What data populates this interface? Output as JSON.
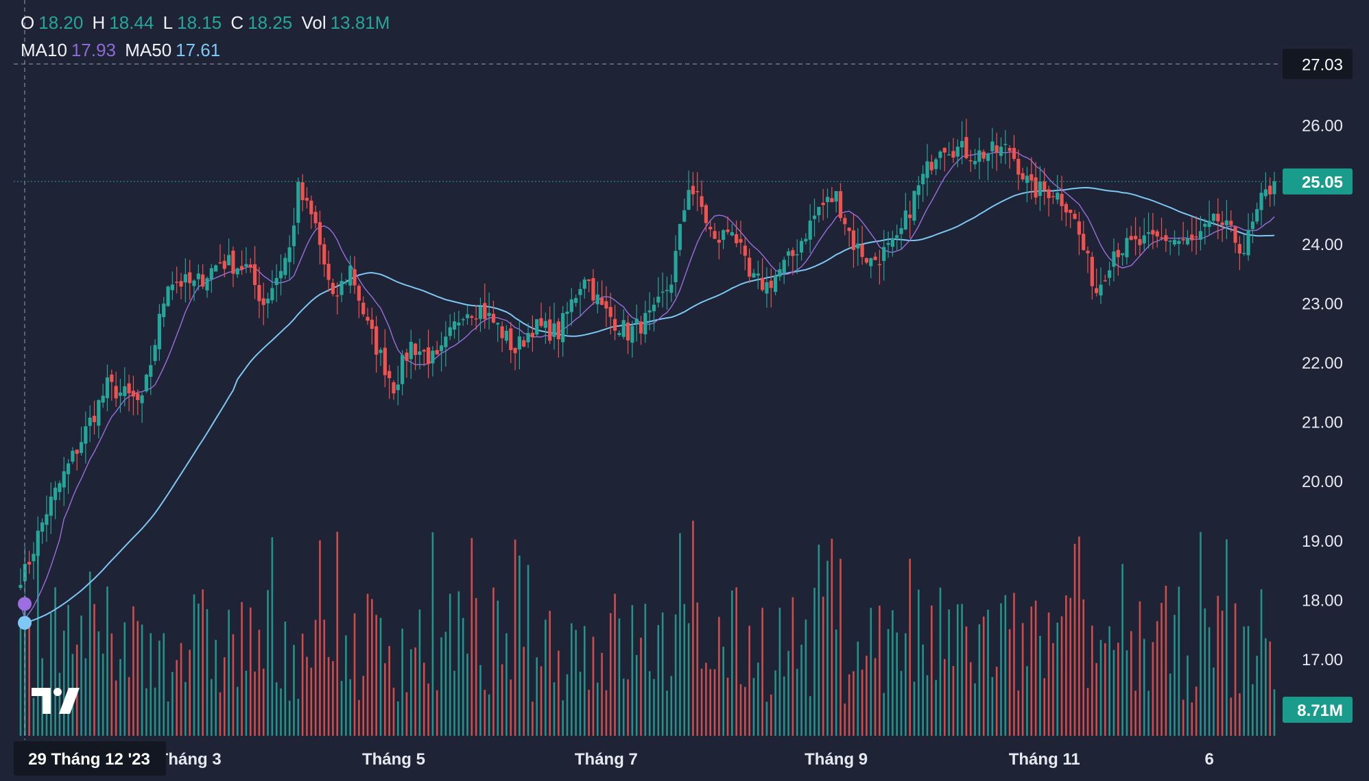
{
  "ohlc_legend": {
    "o_label": "O",
    "o_value": "18.20",
    "h_label": "H",
    "h_value": "18.44",
    "l_label": "L",
    "l_value": "18.15",
    "c_label": "C",
    "c_value": "18.25",
    "vol_label": "Vol",
    "vol_value": "13.81M"
  },
  "ma_legend": {
    "ma10_label": "MA10",
    "ma10_value": "17.93",
    "ma50_label": "MA50",
    "ma50_value": "17.61"
  },
  "colors": {
    "background": "#1e2435",
    "up": "#26a69a",
    "down": "#ef5350",
    "ma10": "#9c6ee0",
    "ma50": "#7ec8f5",
    "axis_text": "#e6e9f0",
    "highlight_badge": "#1a9c8c",
    "crosshair_badge": "#131722"
  },
  "chart_data": {
    "type": "candlestick",
    "y_axis": {
      "ticks": [
        "17.00",
        "18.00",
        "19.00",
        "20.00",
        "21.00",
        "22.00",
        "23.00",
        "24.00",
        "25.00",
        "26.00"
      ],
      "range": [
        16.0,
        27.5
      ],
      "crosshair_price": "27.03",
      "last_price": "25.05"
    },
    "x_axis": {
      "crosshair_label": "29 Tháng 12 '23",
      "tick_labels": [
        "Tháng 3",
        "Tháng 5",
        "Tháng 7",
        "Tháng 9",
        "Tháng 11",
        "6"
      ]
    },
    "volume": {
      "last_volume_label": "8.71M"
    },
    "series": [
      {
        "name": "MA10"
      },
      {
        "name": "MA50"
      }
    ],
    "close_keypoints": [
      [
        0,
        18.25
      ],
      [
        6,
        19.5
      ],
      [
        12,
        20.4
      ],
      [
        20,
        21.6
      ],
      [
        28,
        21.3
      ],
      [
        34,
        23.4
      ],
      [
        40,
        23.3
      ],
      [
        46,
        23.7
      ],
      [
        52,
        23.6
      ],
      [
        56,
        23.0
      ],
      [
        62,
        23.9
      ],
      [
        64,
        24.9
      ],
      [
        68,
        24.3
      ],
      [
        72,
        23.0
      ],
      [
        76,
        23.6
      ],
      [
        80,
        22.6
      ],
      [
        86,
        21.6
      ],
      [
        90,
        22.3
      ],
      [
        96,
        22.0
      ],
      [
        102,
        22.9
      ],
      [
        106,
        22.9
      ],
      [
        110,
        22.6
      ],
      [
        114,
        22.2
      ],
      [
        118,
        22.6
      ],
      [
        124,
        22.5
      ],
      [
        130,
        23.5
      ],
      [
        134,
        22.9
      ],
      [
        140,
        22.5
      ],
      [
        146,
        22.8
      ],
      [
        150,
        23.4
      ],
      [
        154,
        25.0
      ],
      [
        157,
        24.6
      ],
      [
        160,
        24.0
      ],
      [
        164,
        24.3
      ],
      [
        168,
        23.4
      ],
      [
        172,
        23.3
      ],
      [
        178,
        23.8
      ],
      [
        184,
        24.6
      ],
      [
        188,
        24.8
      ],
      [
        192,
        24.0
      ],
      [
        196,
        23.7
      ],
      [
        202,
        24.0
      ],
      [
        206,
        24.8
      ],
      [
        212,
        25.7
      ],
      [
        220,
        25.5
      ],
      [
        228,
        25.6
      ],
      [
        233,
        24.9
      ],
      [
        238,
        24.9
      ],
      [
        242,
        24.6
      ],
      [
        248,
        23.2
      ],
      [
        252,
        23.9
      ],
      [
        258,
        24.0
      ],
      [
        264,
        24.1
      ],
      [
        270,
        24.0
      ],
      [
        276,
        24.4
      ],
      [
        282,
        23.9
      ],
      [
        286,
        24.7
      ],
      [
        289,
        25.05
      ]
    ],
    "n_candles": 290
  }
}
